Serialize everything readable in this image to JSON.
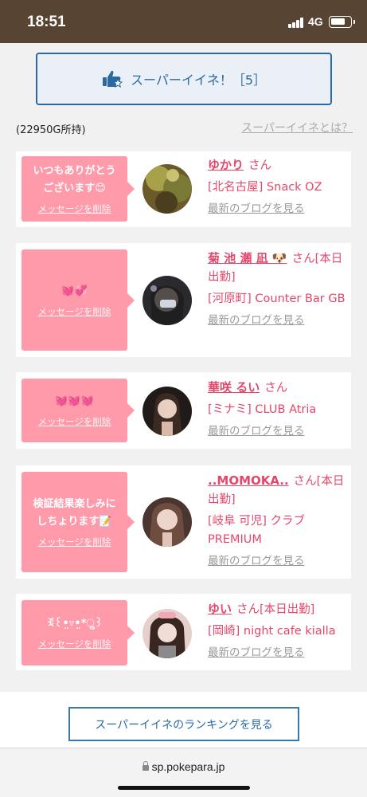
{
  "status_bar": {
    "time": "18:51",
    "network": "4G"
  },
  "super_button": {
    "label": "スーパーイイネ！［5］"
  },
  "gold": "(22950G所持)",
  "what_link": "スーパーイイネとは？",
  "delete_label": "メッセージを削除",
  "blog_label": "最新のブログを見る",
  "cards": [
    {
      "message_lines": [
        "いつもありがとう",
        "ございます😊"
      ],
      "name": "ゆかり",
      "suffix": "さん",
      "shop": "[北名古屋] Snack OZ"
    },
    {
      "message_lines": [
        "💓💞"
      ],
      "name": "菊 池 瀬 凪 🐶",
      "suffix": "さん[本日出勤]",
      "shop": "[河原町] Counter Bar GB"
    },
    {
      "message_lines": [
        "💓💓💓"
      ],
      "name": "華咲 るい",
      "suffix": "さん",
      "shop": "[ミナミ] CLUB Atria"
    },
    {
      "message_lines": [
        "検証結果楽しみに",
        "しちょります📝"
      ],
      "name": "..MOMOKA..",
      "suffix": "さん[本日出勤]",
      "shop": "[岐阜 可児] クラブ PREMIUM"
    },
    {
      "message_lines": [
        "ꉂ꒰•̤▿•̤*ૢ꒱"
      ],
      "name": "ゆい",
      "suffix": "さん[本日出勤]",
      "shop": "[岡崎] night cafe kialla"
    }
  ],
  "ranking_button": "スーパーイイネのランキングを見る",
  "url": "sp.pokepara.jp",
  "colors": {
    "status_bar": "#574433",
    "accent_blue": "#2a6aa4",
    "bubble_pink": "#ff9aaa",
    "name_pink": "#e5476b"
  },
  "icons": {
    "super_button": "thumbs-up-star-icon",
    "url_lock": "lock-icon"
  }
}
